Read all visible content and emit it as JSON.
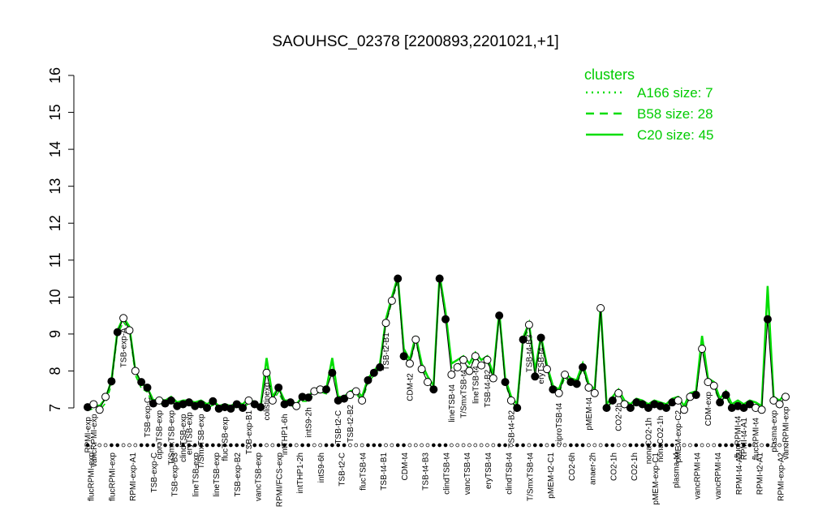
{
  "chart_data": {
    "type": "line",
    "title": "SAOUHSC_02378 [2200893,2201021,+1]",
    "xlabel": "",
    "ylabel": "",
    "ylim": [
      7,
      16
    ],
    "yticks": [
      7,
      8,
      9,
      10,
      11,
      12,
      13,
      14,
      15,
      16
    ],
    "legend": {
      "title": "clusters",
      "placement": "top-right",
      "entries": [
        {
          "label": "A166 size: 7",
          "style": "dotted"
        },
        {
          "label": "B58 size: 28",
          "style": "dashed"
        },
        {
          "label": "C20 size: 45",
          "style": "solid"
        }
      ]
    },
    "colors": {
      "clusters": "#00dd00",
      "points": "#000000",
      "open": "#ffffff",
      "axis": "#000000"
    },
    "bottom_labels": [
      "flucRPMI-exp",
      "flucRPMI-exp",
      "RPMI-exp-A1",
      "TSB-exp-C",
      "TSB-exp-B3",
      "lineTSB-exp",
      "lineTSB-exp",
      "TSB-exp-B2",
      "vancTSB-exp",
      "RPMI/FCS-exp",
      "intTHP1-2h",
      "intS9-6h",
      "TSB-t2-C",
      "flucTSB-t4",
      "TSB-t4-B1",
      "CDM-t4",
      "TSB-t4-B3",
      "clindTSB-t4",
      "vancTSB-t4",
      "eryTSB-t4",
      "clindTSB-t4",
      "T/SmxTSB-t4",
      "pMEM-t2-C1",
      "CO2-6h",
      "anaer-2h",
      "CO2-1h",
      "CO2-1h",
      "pMEM-exp-C1",
      "plasma-t4",
      "vancRPMI-t4",
      "vancRPMI-t4",
      "RPMI-t4-A2",
      "RPMI-t2-A1",
      "RPMI-exp-A2"
    ],
    "points": [
      {
        "label": "RPMI-exp",
        "y": 7.02,
        "filled": true
      },
      {
        "label": "vancRPMI-exp",
        "y": 7.1,
        "filled": false
      },
      {
        "label": "",
        "y": 6.95,
        "filled": false
      },
      {
        "label": "",
        "y": 7.3,
        "filled": false
      },
      {
        "label": "",
        "y": 7.72,
        "filled": true
      },
      {
        "label": "",
        "y": 9.05,
        "filled": true
      },
      {
        "label": "TSB-exp-A",
        "y": 9.43,
        "filled": false
      },
      {
        "label": "",
        "y": 9.1,
        "filled": false
      },
      {
        "label": "",
        "y": 8.0,
        "filled": false
      },
      {
        "label": "",
        "y": 7.7,
        "filled": true
      },
      {
        "label": "TSB-exp-C",
        "y": 7.55,
        "filled": true
      },
      {
        "label": "",
        "y": 7.12,
        "filled": true
      },
      {
        "label": "ciproTSB-exp",
        "y": 7.2,
        "filled": false
      },
      {
        "label": "",
        "y": 7.12,
        "filled": true
      },
      {
        "label": "T/SmxTSB-exp",
        "y": 7.2,
        "filled": true
      },
      {
        "label": "",
        "y": 7.05,
        "filled": true
      },
      {
        "label": "clindTSB-exp",
        "y": 7.1,
        "filled": true
      },
      {
        "label": "eryTSB-exp",
        "y": 7.15,
        "filled": true
      },
      {
        "label": "",
        "y": 7.05,
        "filled": true
      },
      {
        "label": "T/SmxTSB-exp",
        "y": 7.1,
        "filled": true
      },
      {
        "label": "",
        "y": 7.0,
        "filled": true
      },
      {
        "label": "",
        "y": 7.18,
        "filled": true
      },
      {
        "label": "",
        "y": 6.98,
        "filled": true
      },
      {
        "label": "flucTSB-exp",
        "y": 7.02,
        "filled": true
      },
      {
        "label": "",
        "y": 6.98,
        "filled": true
      },
      {
        "label": "",
        "y": 7.1,
        "filled": true
      },
      {
        "label": "",
        "y": 7.0,
        "filled": true
      },
      {
        "label": "TSB-exp-B1",
        "y": 7.2,
        "filled": false
      },
      {
        "label": "",
        "y": 7.1,
        "filled": true
      },
      {
        "label": "",
        "y": 7.02,
        "filled": true
      },
      {
        "label": "colistinexp",
        "y": 7.95,
        "filled": false
      },
      {
        "label": "",
        "y": 7.2,
        "filled": false
      },
      {
        "label": "",
        "y": 7.55,
        "filled": true
      },
      {
        "label": "intTHP1-6h",
        "y": 7.1,
        "filled": true
      },
      {
        "label": "",
        "y": 7.15,
        "filled": true
      },
      {
        "label": "",
        "y": 7.05,
        "filled": false
      },
      {
        "label": "",
        "y": 7.3,
        "filled": true
      },
      {
        "label": "intS9-2h",
        "y": 7.28,
        "filled": true
      },
      {
        "label": "",
        "y": 7.45,
        "filled": false
      },
      {
        "label": "",
        "y": 7.5,
        "filled": false
      },
      {
        "label": "",
        "y": 7.5,
        "filled": true
      },
      {
        "label": "",
        "y": 7.95,
        "filled": true
      },
      {
        "label": "TSB-t2-C",
        "y": 7.2,
        "filled": true
      },
      {
        "label": "",
        "y": 7.25,
        "filled": true
      },
      {
        "label": "TSB-t2-B2",
        "y": 7.35,
        "filled": false
      },
      {
        "label": "",
        "y": 7.45,
        "filled": false
      },
      {
        "label": "",
        "y": 7.2,
        "filled": false
      },
      {
        "label": "",
        "y": 7.75,
        "filled": true
      },
      {
        "label": "",
        "y": 7.95,
        "filled": true
      },
      {
        "label": "",
        "y": 8.1,
        "filled": true
      },
      {
        "label": "TSB-t2-B1",
        "y": 9.3,
        "filled": false
      },
      {
        "label": "",
        "y": 9.9,
        "filled": false
      },
      {
        "label": "",
        "y": 10.5,
        "filled": true
      },
      {
        "label": "",
        "y": 8.4,
        "filled": true
      },
      {
        "label": "CDM-t2",
        "y": 8.2,
        "filled": false
      },
      {
        "label": "",
        "y": 8.85,
        "filled": false
      },
      {
        "label": "",
        "y": 8.05,
        "filled": false
      },
      {
        "label": "",
        "y": 7.7,
        "filled": false
      },
      {
        "label": "",
        "y": 7.5,
        "filled": true
      },
      {
        "label": "",
        "y": 10.5,
        "filled": true
      },
      {
        "label": "",
        "y": 9.4,
        "filled": true
      },
      {
        "label": "lineTSB-t4",
        "y": 7.9,
        "filled": false
      },
      {
        "label": "",
        "y": 8.1,
        "filled": false
      },
      {
        "label": "T/SmxTSB-t4",
        "y": 8.3,
        "filled": false
      },
      {
        "label": "",
        "y": 8.0,
        "filled": false
      },
      {
        "label": "lineTSB-t4",
        "y": 8.4,
        "filled": false
      },
      {
        "label": "",
        "y": 8.15,
        "filled": false
      },
      {
        "label": "TSB-t4-B2",
        "y": 8.3,
        "filled": false
      },
      {
        "label": "",
        "y": 7.8,
        "filled": false
      },
      {
        "label": "",
        "y": 9.5,
        "filled": true
      },
      {
        "label": "",
        "y": 7.7,
        "filled": true
      },
      {
        "label": "TSB-t4-B2",
        "y": 7.2,
        "filled": false
      },
      {
        "label": "",
        "y": 7.0,
        "filled": true
      },
      {
        "label": "",
        "y": 8.85,
        "filled": true
      },
      {
        "label": "TSB-t4-B3",
        "y": 9.25,
        "filled": false
      },
      {
        "label": "",
        "y": 7.85,
        "filled": true
      },
      {
        "label": "eryTSB-t4",
        "y": 8.9,
        "filled": true
      },
      {
        "label": "",
        "y": 8.05,
        "filled": false
      },
      {
        "label": "",
        "y": 7.5,
        "filled": true
      },
      {
        "label": "ciproTSB-t4",
        "y": 7.4,
        "filled": false
      },
      {
        "label": "",
        "y": 7.9,
        "filled": false
      },
      {
        "label": "",
        "y": 7.7,
        "filled": true
      },
      {
        "label": "",
        "y": 7.65,
        "filled": true
      },
      {
        "label": "",
        "y": 8.1,
        "filled": true
      },
      {
        "label": "pMEM-t4",
        "y": 7.55,
        "filled": false
      },
      {
        "label": "",
        "y": 7.4,
        "filled": false
      },
      {
        "label": "",
        "y": 9.7,
        "filled": false
      },
      {
        "label": "",
        "y": 7.0,
        "filled": true
      },
      {
        "label": "",
        "y": 7.2,
        "filled": true
      },
      {
        "label": "CO2-2h",
        "y": 7.4,
        "filled": false
      },
      {
        "label": "",
        "y": 7.1,
        "filled": false
      },
      {
        "label": "",
        "y": 7.0,
        "filled": true
      },
      {
        "label": "",
        "y": 7.15,
        "filled": true
      },
      {
        "label": "",
        "y": 7.1,
        "filled": true
      },
      {
        "label": "nonaCO2-1h",
        "y": 7.0,
        "filled": true
      },
      {
        "label": "",
        "y": 7.1,
        "filled": true
      },
      {
        "label": "nonaCO2-1h",
        "y": 7.05,
        "filled": true
      },
      {
        "label": "",
        "y": 7.0,
        "filled": true
      },
      {
        "label": "",
        "y": 7.15,
        "filled": true
      },
      {
        "label": "pMEM-exp-C2",
        "y": 7.2,
        "filled": false
      },
      {
        "label": "",
        "y": 6.95,
        "filled": false
      },
      {
        "label": "",
        "y": 7.3,
        "filled": false
      },
      {
        "label": "",
        "y": 7.35,
        "filled": true
      },
      {
        "label": "",
        "y": 8.6,
        "filled": false
      },
      {
        "label": "CDM-exp",
        "y": 7.7,
        "filled": false
      },
      {
        "label": "",
        "y": 7.6,
        "filled": false
      },
      {
        "label": "",
        "y": 7.15,
        "filled": true
      },
      {
        "label": "",
        "y": 7.35,
        "filled": true
      },
      {
        "label": "",
        "y": 7.0,
        "filled": true
      },
      {
        "label": "flucRPMI-t4",
        "y": 7.05,
        "filled": true
      },
      {
        "label": "RPMI-t4-A1",
        "y": 7.0,
        "filled": true
      },
      {
        "label": "",
        "y": 7.1,
        "filled": true
      },
      {
        "label": "flucRPMI-t4",
        "y": 7.0,
        "filled": false
      },
      {
        "label": "",
        "y": 6.95,
        "filled": false
      },
      {
        "label": "",
        "y": 9.4,
        "filled": true
      },
      {
        "label": "plasma-exp",
        "y": 7.2,
        "filled": false
      },
      {
        "label": "",
        "y": 7.1,
        "filled": false
      },
      {
        "label": "vancRPMI-exp",
        "y": 7.3,
        "filled": false
      }
    ],
    "cluster_c20": [
      7.05,
      7.1,
      7.05,
      7.25,
      7.75,
      9.1,
      9.45,
      9.2,
      8.0,
      7.65,
      7.55,
      7.2,
      7.25,
      7.2,
      7.3,
      7.15,
      7.2,
      7.2,
      7.15,
      7.2,
      7.1,
      7.2,
      7.05,
      7.1,
      7.05,
      7.15,
      7.1,
      7.25,
      7.15,
      7.05,
      8.35,
      7.3,
      7.55,
      7.2,
      7.2,
      7.1,
      7.3,
      7.3,
      7.5,
      7.55,
      7.5,
      8.35,
      7.3,
      7.3,
      7.45,
      7.5,
      7.3,
      7.8,
      8.0,
      8.2,
      9.4,
      10.0,
      10.55,
      8.6,
      8.3,
      8.95,
      8.2,
      7.85,
      7.6,
      10.6,
      9.6,
      8.2,
      8.3,
      8.4,
      8.2,
      8.5,
      8.3,
      8.4,
      7.9,
      9.6,
      7.8,
      7.3,
      7.1,
      8.9,
      9.3,
      8.0,
      8.95,
      8.15,
      7.6,
      7.5,
      7.95,
      7.8,
      7.75,
      8.2,
      7.65,
      7.5,
      9.75,
      7.1,
      7.3,
      7.5,
      7.2,
      7.1,
      7.25,
      7.2,
      7.1,
      7.2,
      7.15,
      7.1,
      7.25,
      7.3,
      7.05,
      7.4,
      7.45,
      8.95,
      7.8,
      7.7,
      7.25,
      7.45,
      7.1,
      7.2,
      7.1,
      7.2,
      7.15,
      7.05,
      10.3,
      7.3,
      7.2,
      7.4
    ]
  }
}
